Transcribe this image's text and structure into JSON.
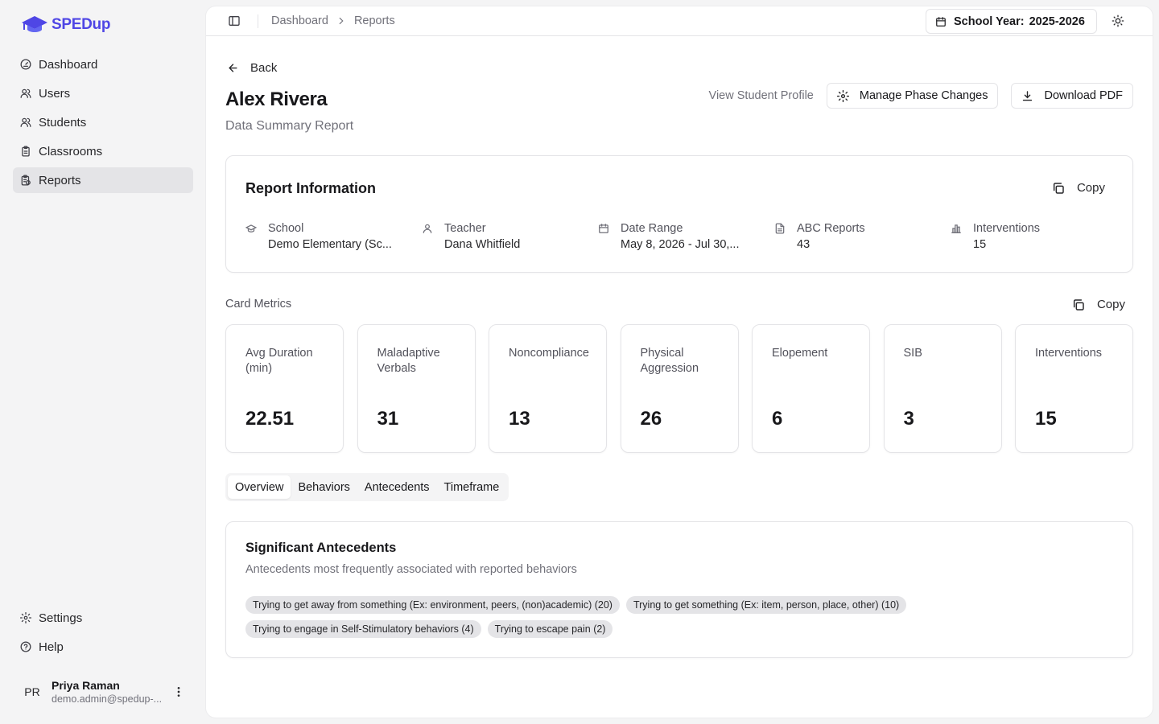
{
  "app": {
    "logo_text": "SPEDup",
    "brand_color": "#4f46e5"
  },
  "sidebar": {
    "items": [
      {
        "label": "Dashboard",
        "icon": "gauge-icon"
      },
      {
        "label": "Users",
        "icon": "users-icon"
      },
      {
        "label": "Students",
        "icon": "users-icon"
      },
      {
        "label": "Classrooms",
        "icon": "clipboard-icon"
      },
      {
        "label": "Reports",
        "icon": "clipboard-report-icon",
        "active": true
      }
    ],
    "bottom_items": [
      {
        "label": "Settings",
        "icon": "gear-icon"
      },
      {
        "label": "Help",
        "icon": "help-circle-icon"
      }
    ],
    "user": {
      "initials": "PR",
      "name": "Priya Raman",
      "email": "demo.admin@spedup-..."
    }
  },
  "topbar": {
    "breadcrumb": [
      "Dashboard",
      "Reports"
    ],
    "school_year_label": "School Year:",
    "school_year_value": "2025-2026"
  },
  "page": {
    "back_label": "Back",
    "title": "Alex Rivera",
    "subtitle": "Data Summary Report",
    "actions": {
      "view_profile": "View Student Profile",
      "manage_phase": "Manage Phase Changes",
      "download_pdf": "Download PDF"
    }
  },
  "report_info": {
    "title": "Report Information",
    "copy_label": "Copy",
    "items": [
      {
        "label": "School",
        "value": "Demo Elementary (Sc...",
        "icon": "graduation-cap-icon"
      },
      {
        "label": "Teacher",
        "value": "Dana Whitfield",
        "icon": "user-icon"
      },
      {
        "label": "Date Range",
        "value": "May 8, 2026 - Jul 30,...",
        "icon": "calendar-icon"
      },
      {
        "label": "ABC Reports",
        "value": "43",
        "icon": "file-text-icon"
      },
      {
        "label": "Interventions",
        "value": "15",
        "icon": "bar-chart-icon"
      }
    ]
  },
  "card_metrics": {
    "label": "Card Metrics",
    "copy_label": "Copy",
    "items": [
      {
        "label": "Avg Duration (min)",
        "value": "22.51"
      },
      {
        "label": "Maladaptive Verbals",
        "value": "31"
      },
      {
        "label": "Noncompliance",
        "value": "13"
      },
      {
        "label": "Physical Aggression",
        "value": "26"
      },
      {
        "label": "Elopement",
        "value": "6"
      },
      {
        "label": "SIB",
        "value": "3"
      },
      {
        "label": "Interventions",
        "value": "15"
      }
    ]
  },
  "tabs": [
    {
      "label": "Overview",
      "active": true
    },
    {
      "label": "Behaviors"
    },
    {
      "label": "Antecedents"
    },
    {
      "label": "Timeframe"
    }
  ],
  "significant_antecedents": {
    "title": "Significant Antecedents",
    "description": "Antecedents most frequently associated with reported behaviors",
    "chips": [
      "Trying to get away from something (Ex: environment, peers, (non)academic) (20)",
      "Trying to get something (Ex: item, person, place, other) (10)",
      "Trying to engage in Self-Stimulatory behaviors (4)",
      "Trying to escape pain (2)"
    ]
  }
}
